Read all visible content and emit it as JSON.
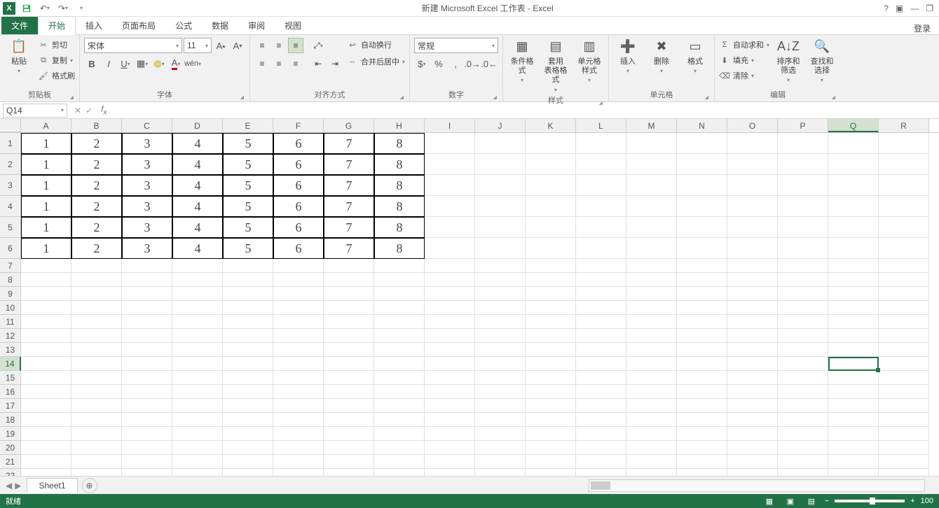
{
  "title": "新建 Microsoft Excel 工作表 - Excel",
  "tabs": {
    "file": "文件",
    "home": "开始",
    "insert": "插入",
    "layout": "页面布局",
    "formulas": "公式",
    "data": "数据",
    "review": "审阅",
    "view": "视图",
    "login": "登录"
  },
  "ribbon": {
    "clipboard": {
      "label": "剪贴板",
      "paste": "粘贴",
      "cut": "剪切",
      "copy": "复制",
      "painter": "格式刷"
    },
    "font": {
      "label": "字体",
      "name": "宋体",
      "size": "11"
    },
    "align": {
      "label": "对齐方式",
      "wrap": "自动换行",
      "merge": "合并后居中"
    },
    "number": {
      "label": "数字",
      "format": "常规"
    },
    "styles": {
      "label": "样式",
      "cond": "条件格式",
      "table": "套用\n表格格式",
      "cell": "单元格样式"
    },
    "cells": {
      "label": "单元格",
      "insert": "插入",
      "delete": "删除",
      "format": "格式"
    },
    "editing": {
      "label": "编辑",
      "sum": "自动求和",
      "fill": "填充",
      "clear": "清除",
      "sort": "排序和筛选",
      "find": "查找和选择"
    }
  },
  "namebox": "Q14",
  "columns": [
    "A",
    "B",
    "C",
    "D",
    "E",
    "F",
    "G",
    "H",
    "I",
    "J",
    "K",
    "L",
    "M",
    "N",
    "O",
    "P",
    "Q",
    "R"
  ],
  "activeCol": "Q",
  "activeRow": 14,
  "dataRows": 6,
  "totalRows": 22,
  "cellData": [
    1,
    2,
    3,
    4,
    5,
    6,
    7,
    8
  ],
  "sheet": {
    "name": "Sheet1"
  },
  "status": {
    "ready": "就绪",
    "zoom": "100"
  }
}
